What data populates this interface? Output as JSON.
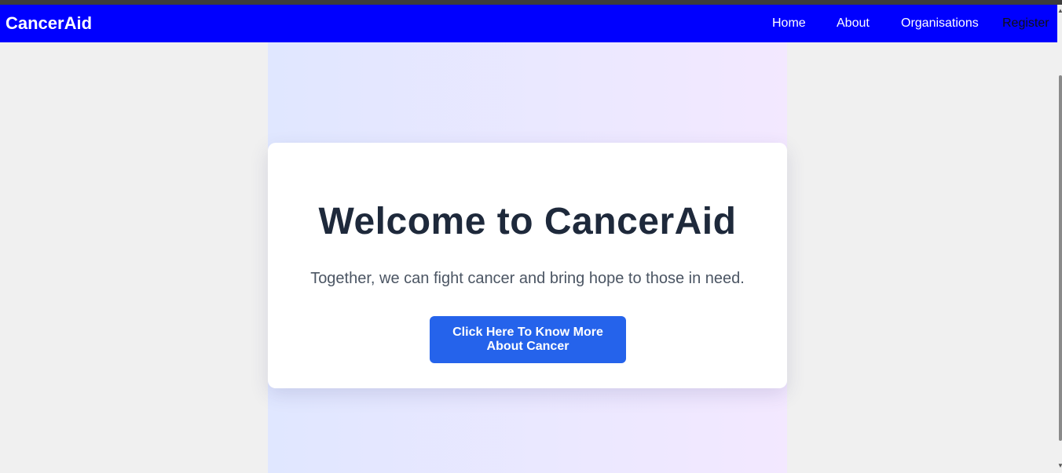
{
  "navbar": {
    "brand": "CancerAid",
    "links": [
      {
        "label": "Home"
      },
      {
        "label": "About"
      },
      {
        "label": "Organisations"
      },
      {
        "label": "Register"
      }
    ]
  },
  "hero": {
    "title": "Welcome to CancerAid",
    "subtitle": "Together, we can fight cancer and bring hope to those in need.",
    "cta_label": "Click Here To Know More About Cancer"
  },
  "colors": {
    "navbar_bg": "#0000ff",
    "button_bg": "#2563eb",
    "title_text": "#1e293b",
    "subtitle_text": "#4b5563",
    "hero_gradient_start": "#e0e7ff",
    "hero_gradient_end": "#f3e8ff"
  }
}
